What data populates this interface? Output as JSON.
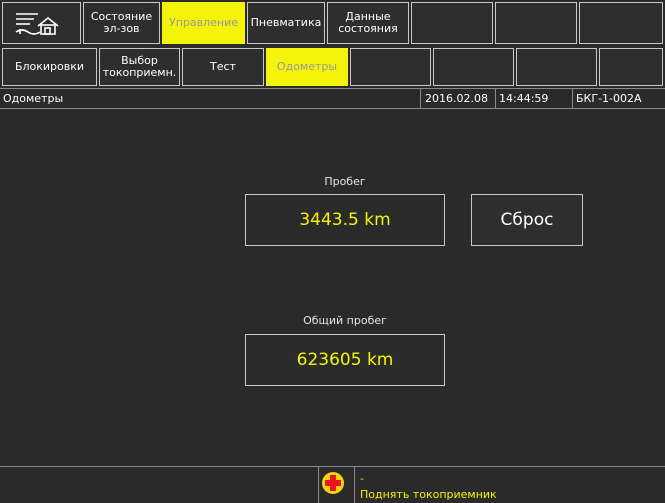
{
  "top_tabs": [
    {
      "label": "",
      "icon": "menu-home-icon"
    },
    {
      "label": "Состояние\nэл-зов"
    },
    {
      "label": "Управление",
      "active": true
    },
    {
      "label": "Пневматика"
    },
    {
      "label": "Данные\nсостояния"
    },
    {
      "label": ""
    },
    {
      "label": ""
    },
    {
      "label": ""
    }
  ],
  "sub_tabs": [
    {
      "label": "Блокировки"
    },
    {
      "label": "Выбор\nтокоприемн."
    },
    {
      "label": "Тест"
    },
    {
      "label": "Одометры",
      "active": true
    },
    {
      "label": ""
    },
    {
      "label": ""
    },
    {
      "label": ""
    },
    {
      "label": ""
    }
  ],
  "status": {
    "title": "Одометры",
    "date": "2016.02.08",
    "time": "14:44:59",
    "unit_id": "БКГ-1-002А"
  },
  "main": {
    "mileage_label": "Пробег",
    "mileage_value": "3443.5 km",
    "reset_label": "Сброс",
    "total_label": "Общий пробег",
    "total_value": "623605 km"
  },
  "alert": {
    "dash": "-",
    "message": "Поднять токоприемник",
    "icon": "red-cross-icon"
  },
  "colors": {
    "background": "#2a2a2a",
    "active_tab": "#f4f40a",
    "value_text": "#f4f40a"
  }
}
